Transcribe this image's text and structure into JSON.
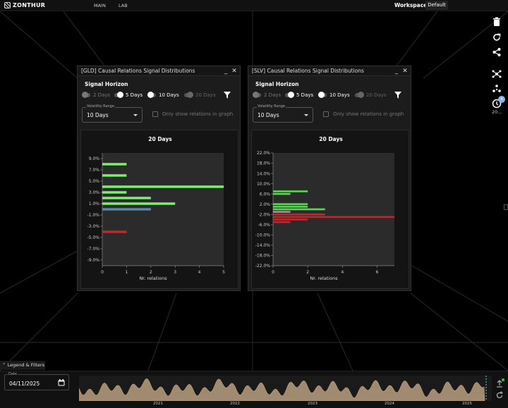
{
  "app": {
    "brand": "ZONTHUR",
    "nav": [
      "MAIN",
      "LAB"
    ],
    "workspace_label": "Workspace:",
    "workspace_value": "Default"
  },
  "rail": {
    "icons": [
      "trash-icon",
      "refresh-icon",
      "share-icon",
      "network-icon",
      "cluster-icon",
      "clock-icon"
    ],
    "clock_label": "20...",
    "badge": "4"
  },
  "panels": [
    {
      "id": "gld",
      "title": "[GLD] Causal Relations Signal Distributions",
      "horizon_label": "Signal Horizon",
      "toggles": [
        {
          "label": "2 Days",
          "state": "off"
        },
        {
          "label": "5 Days",
          "state": "on"
        },
        {
          "label": "10 Days",
          "state": "on"
        },
        {
          "label": "20 Days",
          "state": "dis"
        }
      ],
      "vol_label": "Volatility Range",
      "vol_value": "10 Days",
      "only_label": "Only show relations in graph"
    },
    {
      "id": "slv",
      "title": "[SLV] Causal Relations Signal Distributions",
      "horizon_label": "Signal Horizon",
      "toggles": [
        {
          "label": "2 Days",
          "state": "off"
        },
        {
          "label": "5 Days",
          "state": "on"
        },
        {
          "label": "10 Days",
          "state": "on"
        },
        {
          "label": "20 Days",
          "state": "dis"
        }
      ],
      "vol_label": "Volatility Range",
      "vol_value": "10 Days",
      "only_label": "Only show relations in graph"
    }
  ],
  "chart_data": [
    {
      "type": "bar",
      "orientation": "horizontal",
      "title": "20 Days",
      "xlabel": "Nr. relations",
      "ylabel": "",
      "xlim": [
        0,
        5
      ],
      "ylim": [
        -10,
        10
      ],
      "xticks": [
        0,
        1,
        2,
        3,
        4,
        5
      ],
      "yticks": [
        "9.0%",
        "7.0%",
        "5.0%",
        "3.0%",
        "1.0%",
        "-1.0%",
        "-3.0%",
        "-5.0%",
        "-7.0%",
        "-9.0%"
      ],
      "ytick_values": [
        9,
        7,
        5,
        3,
        1,
        -1,
        -3,
        -5,
        -7,
        -9
      ],
      "bars": [
        {
          "y": 8.0,
          "value": 1,
          "color": "#7bf06e"
        },
        {
          "y": 6.0,
          "value": 1,
          "color": "#7bf06e"
        },
        {
          "y": 4.0,
          "value": 5,
          "color": "#7bf06e"
        },
        {
          "y": 3.0,
          "value": 1,
          "color": "#7bf06e"
        },
        {
          "y": 2.0,
          "value": 2,
          "color": "#7bf06e"
        },
        {
          "y": 1.0,
          "value": 3,
          "color": "#7bf06e"
        },
        {
          "y": 0.0,
          "value": 2,
          "color": "#5b84b0"
        },
        {
          "y": -4.0,
          "value": 1,
          "color": "#c0272d"
        }
      ]
    },
    {
      "type": "bar",
      "orientation": "horizontal",
      "title": "20 Days",
      "xlabel": "Nr. relations",
      "ylabel": "",
      "xlim": [
        0,
        7
      ],
      "ylim": [
        -22,
        22
      ],
      "xticks": [
        0,
        2,
        4,
        6
      ],
      "yticks": [
        "22.0%",
        "18.0%",
        "14.0%",
        "10.0%",
        "6.0%",
        "2.0%",
        "-2.0%",
        "-6.0%",
        "-10.0%",
        "-14.0%",
        "-18.0%",
        "-22.0%"
      ],
      "ytick_values": [
        22,
        18,
        14,
        10,
        6,
        2,
        -2,
        -6,
        -10,
        -14,
        -18,
        -22
      ],
      "bars": [
        {
          "y": 7.0,
          "value": 2,
          "color": "#5fd35a"
        },
        {
          "y": 6.0,
          "value": 1,
          "color": "#5fd35a"
        },
        {
          "y": 2.0,
          "value": 2,
          "color": "#5fd35a"
        },
        {
          "y": 1.0,
          "value": 2,
          "color": "#5fd35a"
        },
        {
          "y": 0.0,
          "value": 3,
          "color": "#5fd35a"
        },
        {
          "y": -1.0,
          "value": 1,
          "color": "#9a9a9a"
        },
        {
          "y": -2.0,
          "value": 3,
          "color": "#c0272d"
        },
        {
          "y": -3.0,
          "value": 7,
          "color": "#c0272d"
        },
        {
          "y": -4.0,
          "value": 2,
          "color": "#c0272d"
        },
        {
          "y": -5.0,
          "value": 1,
          "color": "#c0272d"
        }
      ]
    }
  ],
  "bottom": {
    "legend_label": "Legend & Filters",
    "date_label": "Date",
    "date_value": "04/11/2025",
    "years": [
      "2021",
      "2022",
      "2023",
      "2024",
      "2025"
    ]
  }
}
